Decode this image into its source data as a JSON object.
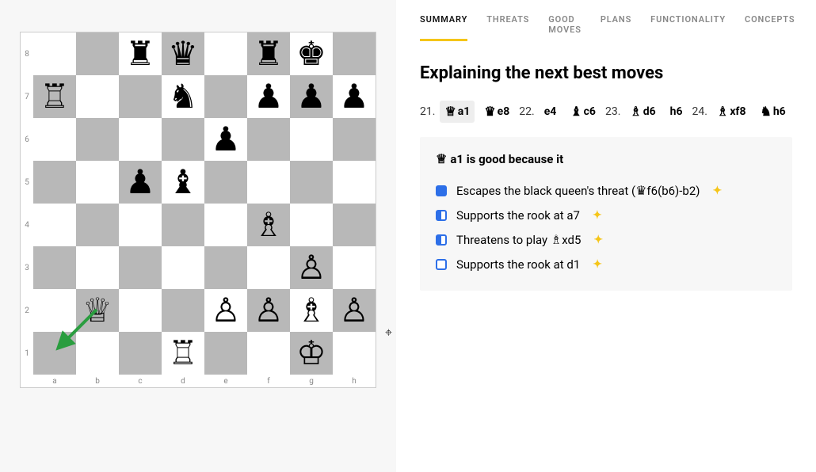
{
  "tabs": [
    {
      "label": "SUMMARY",
      "active": true
    },
    {
      "label": "THREATS",
      "active": false
    },
    {
      "label": "GOOD MOVES",
      "active": false
    },
    {
      "label": "PLANS",
      "active": false
    },
    {
      "label": "FUNCTIONALITY",
      "active": false
    },
    {
      "label": "CONCEPTS",
      "active": false
    }
  ],
  "heading": "Explaining the next best moves",
  "moves": [
    {
      "num": "21.",
      "white": {
        "glyph": "♕",
        "text": "a1",
        "hl": true
      },
      "black": {
        "glyph": "♛",
        "text": "e8"
      }
    },
    {
      "num": "22.",
      "white": {
        "glyph": "",
        "text": "e4"
      },
      "black": {
        "glyph": "♝",
        "text": "c6"
      }
    },
    {
      "num": "23.",
      "white": {
        "glyph": "♗",
        "text": "d6"
      },
      "black": {
        "glyph": "",
        "text": "h6"
      }
    },
    {
      "num": "24.",
      "white": {
        "glyph": "♗",
        "text": "xf8"
      },
      "black": {
        "glyph": "♞",
        "text": "h6"
      }
    }
  ],
  "explain": {
    "title_glyph": "♕",
    "title_text": "a1 is good because it",
    "reasons": [
      {
        "bullet": "full",
        "text_pre": "Escapes the black queen's threat (",
        "inline_glyph": "♛",
        "text_post": "f6(b6)-b2)"
      },
      {
        "bullet": "half",
        "text_pre": "Supports the rook at a7",
        "inline_glyph": "",
        "text_post": ""
      },
      {
        "bullet": "half",
        "text_pre": "Threatens to play ",
        "inline_glyph": "♗",
        "text_post": "xd5"
      },
      {
        "bullet": "outline",
        "text_pre": "Supports the rook at d1",
        "inline_glyph": "",
        "text_post": ""
      }
    ]
  },
  "board": {
    "ranks": [
      "8",
      "7",
      "6",
      "5",
      "4",
      "3",
      "2",
      "1"
    ],
    "files": [
      "a",
      "b",
      "c",
      "d",
      "e",
      "f",
      "g",
      "h"
    ],
    "position": [
      [
        "",
        "",
        "♜",
        "♛",
        "",
        "♜",
        "♚",
        ""
      ],
      [
        "♖",
        "",
        "",
        "♞",
        "",
        "♟",
        "♟",
        "♟"
      ],
      [
        "",
        "",
        "",
        "",
        "♟",
        "",
        "",
        ""
      ],
      [
        "",
        "",
        "♟",
        "♝",
        "",
        "",
        "",
        ""
      ],
      [
        "",
        "",
        "",
        "",
        "",
        "♗",
        "",
        ""
      ],
      [
        "",
        "",
        "",
        "",
        "",
        "",
        "♙",
        ""
      ],
      [
        "",
        "♕",
        "",
        "",
        "♙",
        "♙",
        "♗",
        "♙"
      ],
      [
        "",
        "",
        "",
        "♖",
        "",
        "",
        "♔",
        ""
      ]
    ],
    "arrow": {
      "from": "b2",
      "to": "a1"
    }
  }
}
